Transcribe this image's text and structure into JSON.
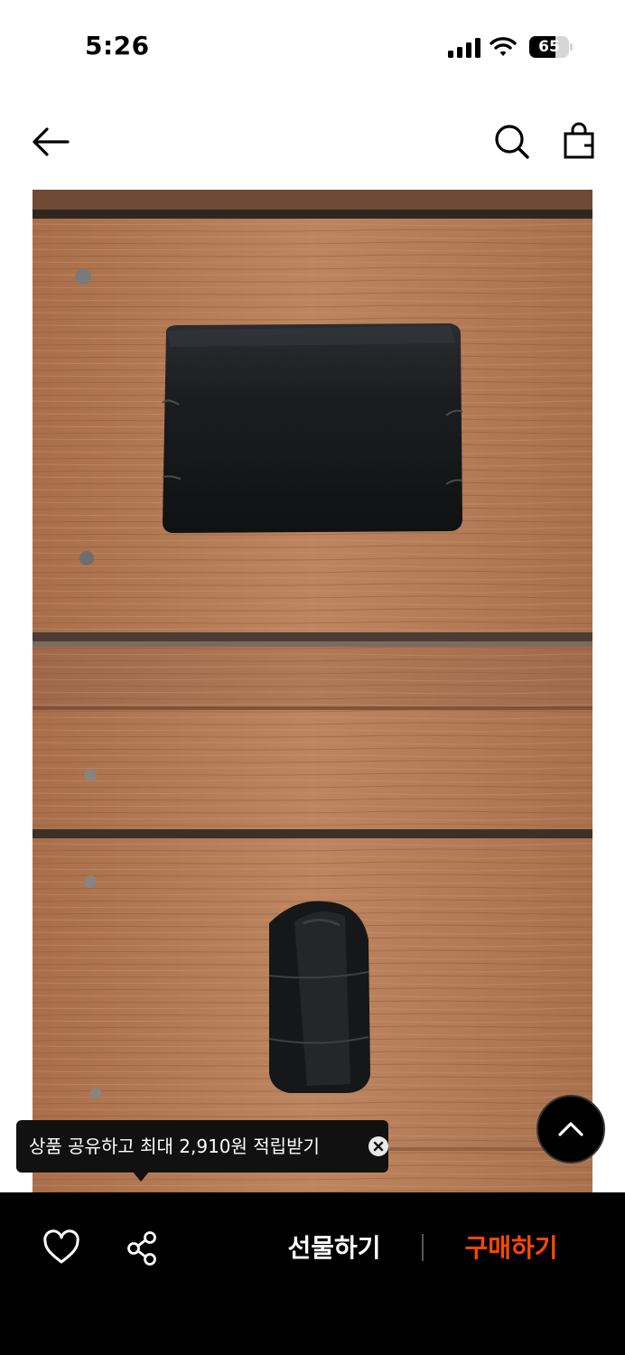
{
  "status_bar": {
    "time": "5:26",
    "battery_level": "65",
    "battery_fraction": 0.65
  },
  "nav": {
    "back_icon": "arrow-left-icon",
    "search_icon": "search-icon",
    "bag_icon": "shopping-bag-icon"
  },
  "product": {
    "image_icon": "product-photo"
  },
  "tooltip": {
    "text": "상품 공유하고 최대 2,910원 적립받기",
    "close_icon": "close-icon"
  },
  "scroll_top_icon": "chevron-up-icon",
  "bottom_bar": {
    "like_icon": "heart-icon",
    "share_icon": "share-icon",
    "gift_label": "선물하기",
    "buy_label": "구매하기"
  },
  "colors": {
    "accent": "#ff4800",
    "bar_background": "#000000",
    "tooltip_background": "#111111"
  }
}
